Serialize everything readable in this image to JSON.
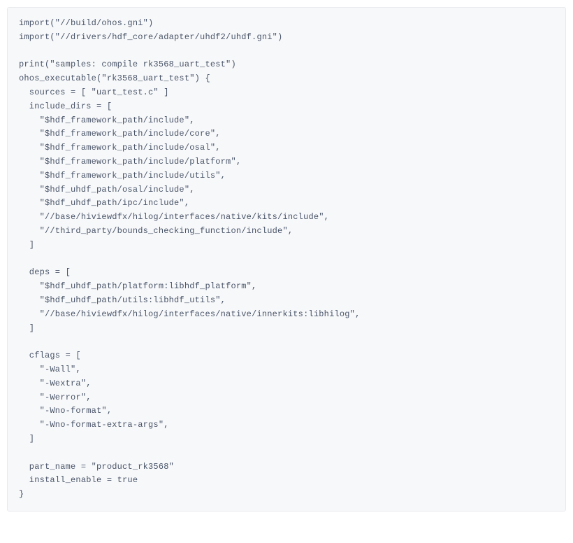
{
  "code": {
    "lines": [
      "import(\"//build/ohos.gni\")",
      "import(\"//drivers/hdf_core/adapter/uhdf2/uhdf.gni\")",
      "",
      "print(\"samples: compile rk3568_uart_test\")",
      "ohos_executable(\"rk3568_uart_test\") {",
      "  sources = [ \"uart_test.c\" ]",
      "  include_dirs = [",
      "    \"$hdf_framework_path/include\",",
      "    \"$hdf_framework_path/include/core\",",
      "    \"$hdf_framework_path/include/osal\",",
      "    \"$hdf_framework_path/include/platform\",",
      "    \"$hdf_framework_path/include/utils\",",
      "    \"$hdf_uhdf_path/osal/include\",",
      "    \"$hdf_uhdf_path/ipc/include\",",
      "    \"//base/hiviewdfx/hilog/interfaces/native/kits/include\",",
      "    \"//third_party/bounds_checking_function/include\",",
      "  ]",
      "",
      "  deps = [",
      "    \"$hdf_uhdf_path/platform:libhdf_platform\",",
      "    \"$hdf_uhdf_path/utils:libhdf_utils\",",
      "    \"//base/hiviewdfx/hilog/interfaces/native/innerkits:libhilog\",",
      "  ]",
      "",
      "  cflags = [",
      "    \"-Wall\",",
      "    \"-Wextra\",",
      "    \"-Werror\",",
      "    \"-Wno-format\",",
      "    \"-Wno-format-extra-args\",",
      "  ]",
      "",
      "  part_name = \"product_rk3568\"",
      "  install_enable = true",
      "}"
    ]
  }
}
